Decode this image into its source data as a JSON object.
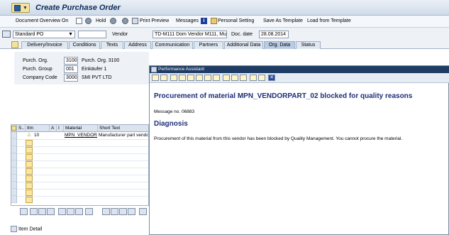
{
  "window": {
    "title": "Create Purchase Order"
  },
  "toolbar": {
    "doc_overview": "Document Overview On",
    "hold": "Hold",
    "print_preview": "Print Preview",
    "messages": "Messages",
    "personal_setting": "Personal Setting",
    "save_template": "Save As Template",
    "load_template": "Load from Template"
  },
  "header": {
    "doc_type": "Standard PO",
    "vendor_label": "Vendor",
    "vendor_value": "TD-M111 Dom Vendor M111, Mu..",
    "doc_date_label": "Doc. date",
    "doc_date_value": "28.08.2014"
  },
  "tabs": [
    "Delivery/Invoice",
    "Conditions",
    "Texts",
    "Address",
    "Communication",
    "Partners",
    "Additional Data",
    "Org. Data",
    "Status"
  ],
  "org": {
    "purch_org_label": "Purch. Org.",
    "purch_org_code": "3100",
    "purch_org_desc": "Purch. Org. 3100",
    "purch_group_label": "Purch. Group",
    "purch_group_code": "001",
    "purch_group_desc": "Einkäufer 1",
    "company_label": "Company Code",
    "company_code": "3000",
    "company_desc": "SMI PVT LTD"
  },
  "items": {
    "headers": [
      "S..",
      "Itm",
      "A",
      "I",
      "Material",
      "Short Text"
    ],
    "rows": [
      {
        "itm": "10",
        "material": "MPN_VENDORP..",
        "short_text": "Manufacturer part vendor"
      }
    ]
  },
  "item_detail": "Item Detail",
  "perf_assistant": {
    "title": "Performance Assistant",
    "heading": "Procurement of material MPN_VENDORPART_02 blocked for quality reasons",
    "message_no": "Message no. 06883",
    "diagnosis_title": "Diagnosis",
    "diagnosis_text": "Procurement of this material from this vendor has been blocked by Quality Management. You cannot procure the material."
  },
  "colors": {
    "title_text": "#0d2d5c",
    "pa_heading": "#1c2e79",
    "pa_titlebar": "#1e3c64"
  }
}
